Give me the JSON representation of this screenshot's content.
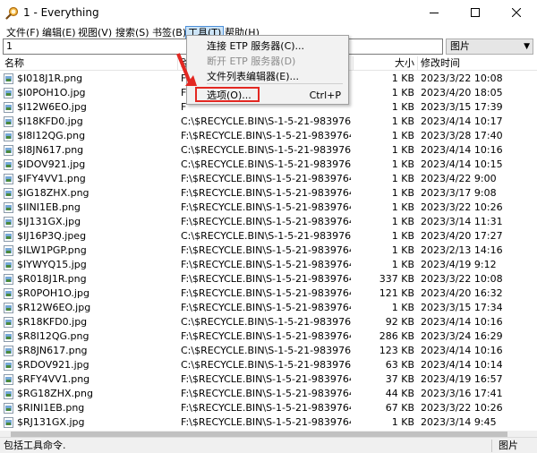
{
  "window": {
    "title": "1 - Everything",
    "icon": "magnifier-icon"
  },
  "menubar": {
    "items": [
      {
        "label": "文件(F)"
      },
      {
        "label": "编辑(E)"
      },
      {
        "label": "视图(V)"
      },
      {
        "label": "搜索(S)"
      },
      {
        "label": "书签(B)"
      },
      {
        "label": "工具(T)"
      },
      {
        "label": "帮助(H)"
      }
    ]
  },
  "search": {
    "value": "1",
    "filter": "图片"
  },
  "columns": {
    "name": "名称",
    "path": "路",
    "size": "大小",
    "modified": "修改时间"
  },
  "tools_menu": {
    "items": [
      {
        "label": "连接 ETP 服务器(C)...",
        "shortcut": "",
        "disabled": false
      },
      {
        "label": "断开 ETP 服务器(D)",
        "shortcut": "",
        "disabled": true
      },
      {
        "label": "文件列表编辑器(E)...",
        "shortcut": "",
        "disabled": false
      },
      {
        "label": "选项(O)...",
        "shortcut": "Ctrl+P",
        "disabled": false
      }
    ]
  },
  "files": [
    {
      "name": "$I018J1R.png",
      "path": "F",
      "size": "1 KB",
      "modified": "2023/3/22 10:08"
    },
    {
      "name": "$I0POH1O.jpg",
      "path": "F",
      "size": "1 KB",
      "modified": "2023/4/20 18:05"
    },
    {
      "name": "$I12W6EO.jpg",
      "path": "F",
      "size": "1 KB",
      "modified": "2023/3/15 17:39"
    },
    {
      "name": "$I18KFD0.jpg",
      "path": "C:\\$RECYCLE.BIN\\S-1-5-21-983976487-1...",
      "size": "1 KB",
      "modified": "2023/4/14 10:17"
    },
    {
      "name": "$I8I12QG.png",
      "path": "F:\\$RECYCLE.BIN\\S-1-5-21-983976487-10...",
      "size": "1 KB",
      "modified": "2023/3/28 17:40"
    },
    {
      "name": "$I8JN617.png",
      "path": "C:\\$RECYCLE.BIN\\S-1-5-21-983976487-1...",
      "size": "1 KB",
      "modified": "2023/4/14 10:16"
    },
    {
      "name": "$IDOV921.jpg",
      "path": "C:\\$RECYCLE.BIN\\S-1-5-21-983976487-1...",
      "size": "1 KB",
      "modified": "2023/4/14 10:15"
    },
    {
      "name": "$IFY4VV1.png",
      "path": "F:\\$RECYCLE.BIN\\S-1-5-21-983976487-10...",
      "size": "1 KB",
      "modified": "2023/4/22 9:00"
    },
    {
      "name": "$IG18ZHX.png",
      "path": "F:\\$RECYCLE.BIN\\S-1-5-21-983976487-10...",
      "size": "1 KB",
      "modified": "2023/3/17 9:08"
    },
    {
      "name": "$IINI1EB.png",
      "path": "F:\\$RECYCLE.BIN\\S-1-5-21-983976487-10...",
      "size": "1 KB",
      "modified": "2023/3/22 10:26"
    },
    {
      "name": "$IJ131GX.jpg",
      "path": "F:\\$RECYCLE.BIN\\S-1-5-21-983976487-10...",
      "size": "1 KB",
      "modified": "2023/3/14 11:31"
    },
    {
      "name": "$IJ16P3Q.jpeg",
      "path": "C:\\$RECYCLE.BIN\\S-1-5-21-983976487-1...",
      "size": "1 KB",
      "modified": "2023/4/20 17:27"
    },
    {
      "name": "$ILW1PGP.png",
      "path": "F:\\$RECYCLE.BIN\\S-1-5-21-983976487-10...",
      "size": "1 KB",
      "modified": "2023/2/13 14:16"
    },
    {
      "name": "$IYWYQ15.jpg",
      "path": "F:\\$RECYCLE.BIN\\S-1-5-21-983976487-10...",
      "size": "1 KB",
      "modified": "2023/4/19 9:12"
    },
    {
      "name": "$R018J1R.png",
      "path": "F:\\$RECYCLE.BIN\\S-1-5-21-983976487-10...",
      "size": "337 KB",
      "modified": "2023/3/22 10:08"
    },
    {
      "name": "$R0POH1O.jpg",
      "path": "F:\\$RECYCLE.BIN\\S-1-5-21-983976487-10...",
      "size": "121 KB",
      "modified": "2023/4/20 16:32"
    },
    {
      "name": "$R12W6EO.jpg",
      "path": "F:\\$RECYCLE.BIN\\S-1-5-21-983976487-10...",
      "size": "1 KB",
      "modified": "2023/3/15 17:34"
    },
    {
      "name": "$R18KFD0.jpg",
      "path": "C:\\$RECYCLE.BIN\\S-1-5-21-983976487-1...",
      "size": "92 KB",
      "modified": "2023/4/14 10:16"
    },
    {
      "name": "$R8I12QG.png",
      "path": "F:\\$RECYCLE.BIN\\S-1-5-21-983976487-10...",
      "size": "286 KB",
      "modified": "2023/3/24 16:29"
    },
    {
      "name": "$R8JN617.png",
      "path": "C:\\$RECYCLE.BIN\\S-1-5-21-983976487-1...",
      "size": "123 KB",
      "modified": "2023/4/14 10:16"
    },
    {
      "name": "$RDOV921.jpg",
      "path": "C:\\$RECYCLE.BIN\\S-1-5-21-983976487-1...",
      "size": "63 KB",
      "modified": "2023/4/14 10:14"
    },
    {
      "name": "$RFY4VV1.png",
      "path": "F:\\$RECYCLE.BIN\\S-1-5-21-983976487-10...",
      "size": "37 KB",
      "modified": "2023/4/19 16:57"
    },
    {
      "name": "$RG18ZHX.png",
      "path": "F:\\$RECYCLE.BIN\\S-1-5-21-983976487-10...",
      "size": "44 KB",
      "modified": "2023/3/16 17:41"
    },
    {
      "name": "$RINI1EB.png",
      "path": "F:\\$RECYCLE.BIN\\S-1-5-21-983976487-10...",
      "size": "67 KB",
      "modified": "2023/3/22 10:26"
    },
    {
      "name": "$RJ131GX.jpg",
      "path": "F:\\$RECYCLE.BIN\\S-1-5-21-983976487-10...",
      "size": "1 KB",
      "modified": "2023/3/14 9:45"
    }
  ],
  "status": {
    "text": "包括工具命令.",
    "right": "图片"
  }
}
